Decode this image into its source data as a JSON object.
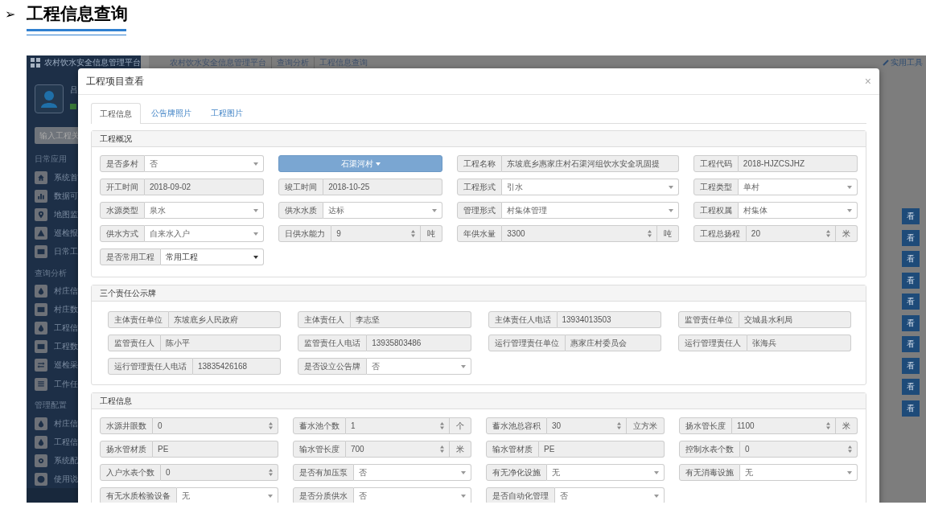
{
  "page_title": {
    "bullet": "➢",
    "text": "工程信息查询"
  },
  "app": {
    "title": "农村饮水安全信息管理平台",
    "user_name": "吕",
    "search_placeholder": "输入工程关",
    "sections": [
      {
        "title": "日常应用",
        "items": [
          "系统首",
          "数据可",
          "地图监",
          "巡检报",
          "日常工"
        ]
      },
      {
        "title": "查询分析",
        "items": [
          "村庄信",
          "村庄数",
          "工程信",
          "工程数",
          "巡检采",
          "工作任"
        ]
      },
      {
        "title": "管理配置",
        "items": [
          "村庄信",
          "工程信",
          "系统配",
          "使用说"
        ]
      }
    ]
  },
  "breadcrumb": [
    "农村饮水安全信息管理平台",
    "查询分析",
    "工程信息查询"
  ],
  "tools_menu": "实用工具",
  "background_buttons": [
    "看",
    "看",
    "看",
    "看",
    "看",
    "看",
    "看",
    "看",
    "看",
    "看"
  ],
  "modal": {
    "title": "工程项目查看",
    "close": "×",
    "tabs": [
      {
        "label": "工程信息",
        "selected": true
      },
      {
        "label": "公告牌照片",
        "selected": false
      },
      {
        "label": "工程图片",
        "selected": false
      }
    ],
    "panels": [
      {
        "title": "工程概况",
        "fields": [
          {
            "kind": "select",
            "label": "是否多村",
            "value": "否",
            "disabled": true
          },
          {
            "kind": "button",
            "value": "石渠河村"
          },
          {
            "kind": "text",
            "label": "工程名称",
            "value": "东坡底乡惠家庄村石渠河组饮水安全巩固提"
          },
          {
            "kind": "text",
            "label": "工程代码",
            "value": "2018-HJZCSJHZ"
          },
          {
            "kind": "text",
            "label": "开工时间",
            "value": "2018-09-02"
          },
          {
            "kind": "text",
            "label": "竣工时间",
            "value": "2018-10-25"
          },
          {
            "kind": "select",
            "label": "工程形式",
            "value": "引水",
            "disabled": true
          },
          {
            "kind": "select",
            "label": "工程类型",
            "value": "单村",
            "disabled": true
          },
          {
            "kind": "select",
            "label": "水源类型",
            "value": "泉水",
            "disabled": true
          },
          {
            "kind": "select",
            "label": "供水水质",
            "value": "达标",
            "disabled": true
          },
          {
            "kind": "select",
            "label": "管理形式",
            "value": "村集体管理",
            "disabled": true
          },
          {
            "kind": "select",
            "label": "工程权属",
            "value": "村集体",
            "disabled": true
          },
          {
            "kind": "select",
            "label": "供水方式",
            "value": "自来水入户",
            "disabled": true
          },
          {
            "kind": "number",
            "label": "日供水能力",
            "value": "9",
            "unit": "吨"
          },
          {
            "kind": "number",
            "label": "年供水量",
            "value": "3300",
            "unit": "吨"
          },
          {
            "kind": "number",
            "label": "工程总扬程",
            "value": "20",
            "unit": "米"
          },
          {
            "kind": "select",
            "label": "是否常用工程",
            "value": "常用工程",
            "disabled": false
          }
        ]
      },
      {
        "title": "三个责任公示牌",
        "fields": [
          {
            "kind": "text",
            "label": "主体责任单位",
            "value": "东坡底乡人民政府"
          },
          {
            "kind": "text",
            "label": "主体责任人",
            "value": "李志坚"
          },
          {
            "kind": "text",
            "label": "主体责任人电话",
            "value": "13934013503"
          },
          {
            "kind": "text",
            "label": "监管责任单位",
            "value": "交城县水利局"
          },
          {
            "kind": "text",
            "label": "监管责任人",
            "value": "陈小平"
          },
          {
            "kind": "text",
            "label": "监管责任人电话",
            "value": "13935803486"
          },
          {
            "kind": "text",
            "label": "运行管理责任单位",
            "value": "惠家庄村委员会"
          },
          {
            "kind": "text",
            "label": "运行管理责任人",
            "value": "张海兵"
          },
          {
            "kind": "text",
            "label": "运行管理责任人电话",
            "value": "13835426168"
          },
          {
            "kind": "select",
            "label": "是否设立公告牌",
            "value": "否",
            "disabled": true
          }
        ]
      },
      {
        "title": "工程信息",
        "fields": [
          {
            "kind": "number",
            "label": "水源井眼数",
            "value": "0"
          },
          {
            "kind": "number",
            "label": "蓄水池个数",
            "value": "1",
            "unit": "个"
          },
          {
            "kind": "number",
            "label": "蓄水池总容积",
            "value": "30",
            "unit": "立方米"
          },
          {
            "kind": "number",
            "label": "扬水管长度",
            "value": "1100",
            "unit": "米"
          },
          {
            "kind": "text",
            "label": "扬水管材质",
            "value": "PE"
          },
          {
            "kind": "number",
            "label": "输水管长度",
            "value": "700",
            "unit": "米"
          },
          {
            "kind": "text",
            "label": "输水管材质",
            "value": "PE"
          },
          {
            "kind": "number",
            "label": "控制水表个数",
            "value": "0"
          },
          {
            "kind": "number",
            "label": "入户水表个数",
            "value": "0"
          },
          {
            "kind": "select",
            "label": "是否有加压泵",
            "value": "否",
            "disabled": true
          },
          {
            "kind": "select",
            "label": "有无净化设施",
            "value": "无",
            "disabled": true
          },
          {
            "kind": "select",
            "label": "有无消毒设施",
            "value": "无",
            "disabled": true
          },
          {
            "kind": "select",
            "label": "有无水质检验设备",
            "value": "无",
            "disabled": true
          },
          {
            "kind": "select",
            "label": "是否分质供水",
            "value": "否",
            "disabled": true
          },
          {
            "kind": "select",
            "label": "是否自动化管理",
            "value": "否",
            "disabled": true
          }
        ]
      }
    ]
  }
}
